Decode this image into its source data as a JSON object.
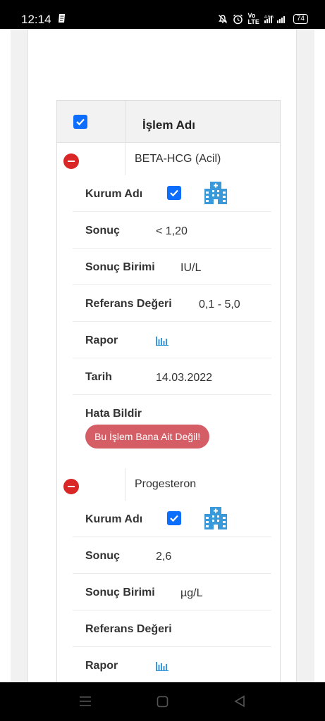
{
  "status_bar": {
    "time": "12:14",
    "battery": "74",
    "network": "4.5G"
  },
  "table": {
    "header_title": "İşlem Adı",
    "header_checked": true,
    "rows": [
      {
        "name": "BETA-HCG (Acil)",
        "details": {
          "kurum_label": "Kurum Adı",
          "sonuc_label": "Sonuç",
          "sonuc_value": "< 1,20",
          "birim_label": "Sonuç Birimi",
          "birim_value": "IU/L",
          "referans_label": "Referans Değeri",
          "referans_value": "0,1 - 5,0",
          "rapor_label": "Rapor",
          "tarih_label": "Tarih",
          "tarih_value": "14.03.2022",
          "hata_label": "Hata Bildir",
          "hata_button": "Bu İşlem Bana Ait Değil!"
        }
      },
      {
        "name": "Progesteron",
        "details": {
          "kurum_label": "Kurum Adı",
          "sonuc_label": "Sonuç",
          "sonuc_value": "2,6",
          "birim_label": "Sonuç Birimi",
          "birim_value": "µg/L",
          "referans_label": "Referans Değeri",
          "referans_value": "",
          "rapor_label": "Rapor"
        }
      }
    ]
  },
  "colors": {
    "accent": "#0d6efd",
    "danger": "#d92626",
    "report_button": "#d45d66",
    "icon_blue": "#3a9ad9"
  },
  "icons": [
    "notification-icon",
    "mute-icon",
    "alarm-icon",
    "volte-icon",
    "signal-icon",
    "battery-icon",
    "checkbox-icon",
    "minus-circle-icon",
    "hospital-icon",
    "bar-chart-icon",
    "menu-icon",
    "home-icon",
    "back-icon"
  ]
}
